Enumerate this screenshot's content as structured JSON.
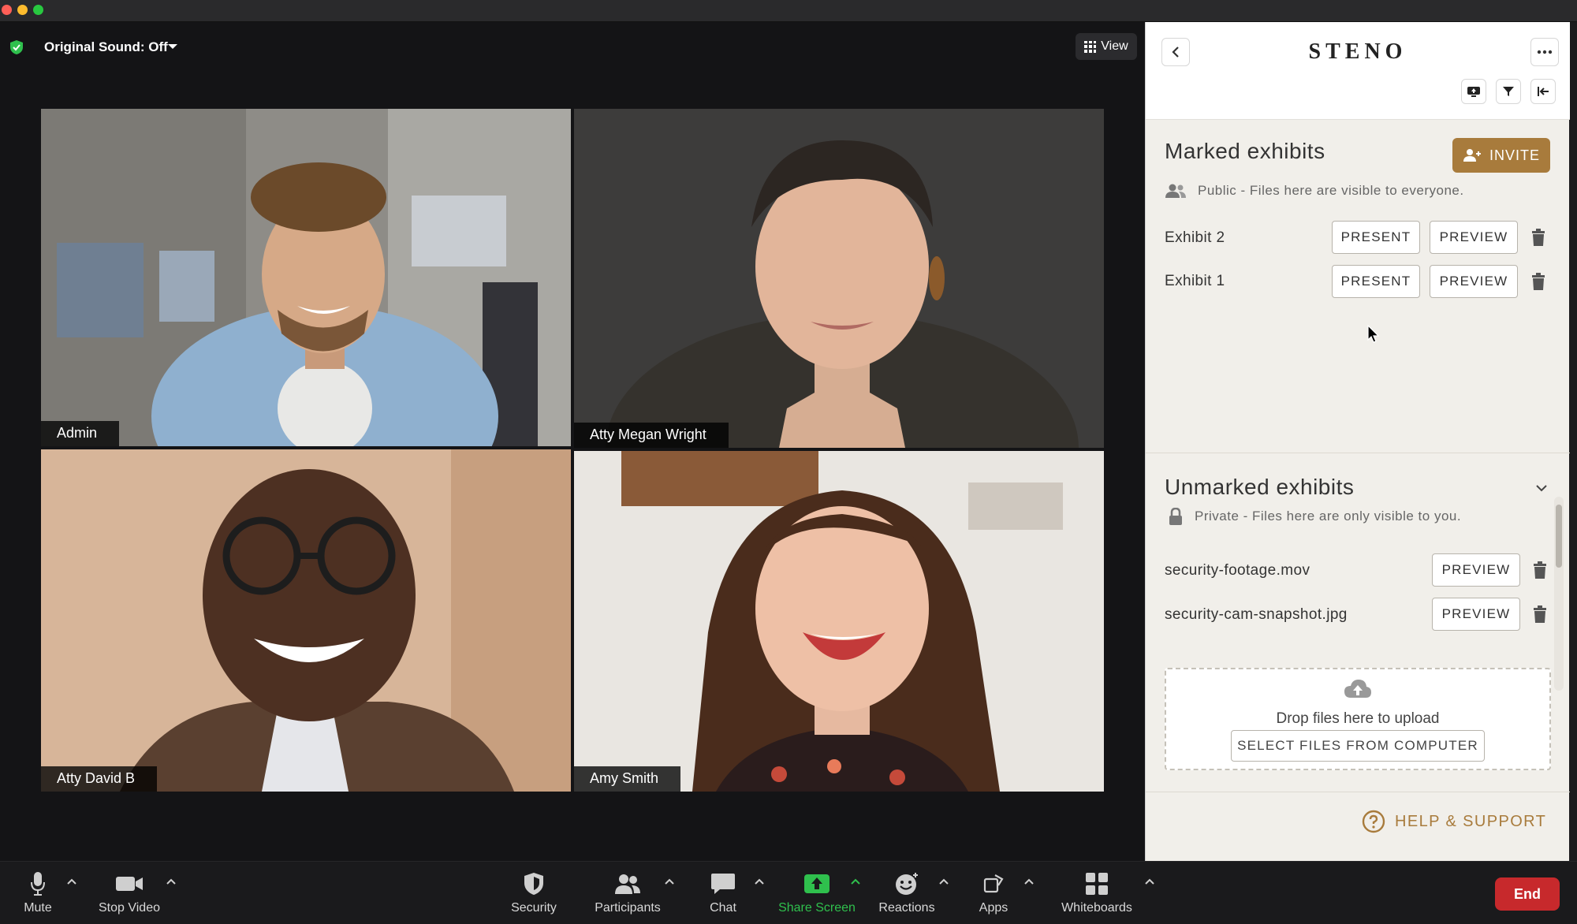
{
  "meeting": {
    "original_sound": "Original Sound: Off",
    "view_label": "View",
    "participants": [
      {
        "name": "Admin"
      },
      {
        "name": "Atty Megan Wright"
      },
      {
        "name": "Atty David B"
      },
      {
        "name": "Amy Smith"
      }
    ]
  },
  "toolbar": {
    "mute": "Mute",
    "stop_video": "Stop Video",
    "security": "Security",
    "participants": "Participants",
    "chat": "Chat",
    "share_screen": "Share Screen",
    "reactions": "Reactions",
    "apps": "Apps",
    "whiteboards": "Whiteboards",
    "end": "End"
  },
  "panel": {
    "brand": "STENO",
    "marked": {
      "title": "Marked exhibits",
      "invite": "INVITE",
      "visibility": "Public - Files here are visible to everyone.",
      "items": [
        {
          "name": "Exhibit 2",
          "present": "PRESENT",
          "preview": "PREVIEW"
        },
        {
          "name": "Exhibit 1",
          "present": "PRESENT",
          "preview": "PREVIEW"
        }
      ]
    },
    "unmarked": {
      "title": "Unmarked exhibits",
      "visibility": "Private - Files here are only visible to you.",
      "items": [
        {
          "name": "security-footage.mov",
          "preview": "PREVIEW"
        },
        {
          "name": "security-cam-snapshot.jpg",
          "preview": "PREVIEW"
        }
      ]
    },
    "upload": {
      "drop_text": "Drop files here to upload",
      "select_button": "SELECT FILES FROM COMPUTER"
    },
    "help": "HELP & SUPPORT"
  },
  "colors": {
    "accent": "#a87b3c",
    "active_speaker": "#2fc04d",
    "end_button": "#c7292c",
    "share_screen": "#2fc04d"
  }
}
